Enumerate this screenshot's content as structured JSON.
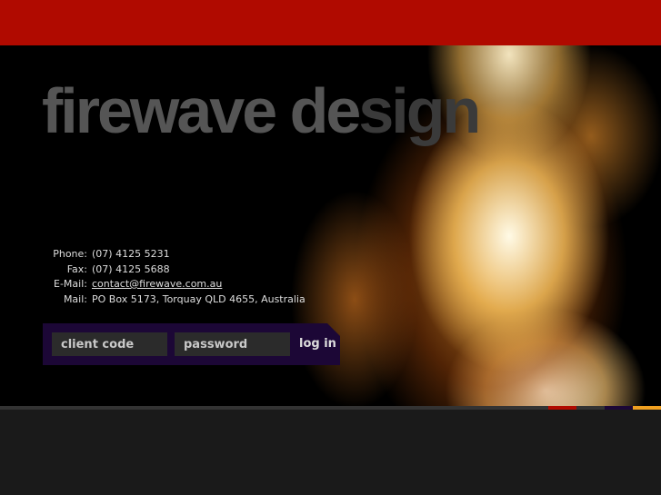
{
  "brand": {
    "logo_light": "firewave de",
    "logo_dark": "sign"
  },
  "contact": [
    {
      "label": "Phone:",
      "value": "(07) 4125 5231"
    },
    {
      "label": "Fax:",
      "value": "(07) 4125 5688"
    },
    {
      "label": "E-Mail:",
      "value": "contact@firewave.com.au"
    },
    {
      "label": "Mail:",
      "value": "PO Box 5173, Torquay QLD 4655, Australia"
    }
  ],
  "login": {
    "client_placeholder": "client code",
    "password_placeholder": "password",
    "button": "log in"
  },
  "colors": {
    "red": "#b00a00",
    "purple": "#1c0736",
    "orange": "#f0a020"
  }
}
